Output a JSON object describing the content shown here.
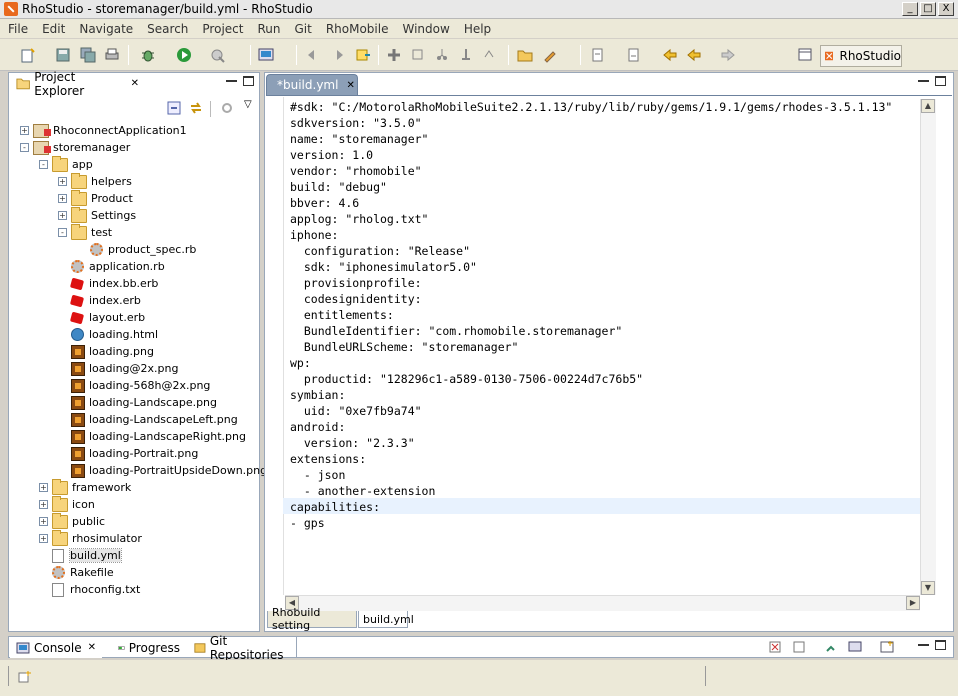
{
  "window": {
    "title": "RhoStudio - storemanager/build.yml - RhoStudio",
    "min": "_",
    "max": "□",
    "close": "X"
  },
  "menu": [
    "File",
    "Edit",
    "Navigate",
    "Search",
    "Project",
    "Run",
    "Git",
    "RhoMobile",
    "Window",
    "Help"
  ],
  "toolbar": {
    "perspective_label": "RhoStudio"
  },
  "project_explorer": {
    "tab_label": "Project Explorer",
    "tree": [
      {
        "label": "RhoconnectApplication1",
        "icon": "project-icon",
        "depth": 0,
        "toggle": "+"
      },
      {
        "label": "storemanager",
        "icon": "project-icon",
        "depth": 0,
        "toggle": "-"
      },
      {
        "label": "app",
        "icon": "folder-icon",
        "depth": 1,
        "toggle": "-"
      },
      {
        "label": "helpers",
        "icon": "folder-icon",
        "depth": 2,
        "toggle": "+"
      },
      {
        "label": "Product",
        "icon": "folder-icon",
        "depth": 2,
        "toggle": "+"
      },
      {
        "label": "Settings",
        "icon": "folder-icon",
        "depth": 2,
        "toggle": "+"
      },
      {
        "label": "test",
        "icon": "folder-icon",
        "depth": 2,
        "toggle": "-"
      },
      {
        "label": "product_spec.rb",
        "icon": "ruby-script-icon",
        "depth": 3
      },
      {
        "label": "application.rb",
        "icon": "ruby-script-icon",
        "depth": 2
      },
      {
        "label": "index.bb.erb",
        "icon": "ruby-icon",
        "depth": 2
      },
      {
        "label": "index.erb",
        "icon": "ruby-icon",
        "depth": 2
      },
      {
        "label": "layout.erb",
        "icon": "ruby-icon",
        "depth": 2
      },
      {
        "label": "loading.html",
        "icon": "globe-icon",
        "depth": 2
      },
      {
        "label": "loading.png",
        "icon": "image-icon",
        "depth": 2
      },
      {
        "label": "loading@2x.png",
        "icon": "image-icon",
        "depth": 2
      },
      {
        "label": "loading-568h@2x.png",
        "icon": "image-icon",
        "depth": 2
      },
      {
        "label": "loading-Landscape.png",
        "icon": "image-icon",
        "depth": 2
      },
      {
        "label": "loading-LandscapeLeft.png",
        "icon": "image-icon",
        "depth": 2
      },
      {
        "label": "loading-LandscapeRight.png",
        "icon": "image-icon",
        "depth": 2
      },
      {
        "label": "loading-Portrait.png",
        "icon": "image-icon",
        "depth": 2
      },
      {
        "label": "loading-PortraitUpsideDown.png",
        "icon": "image-icon",
        "depth": 2
      },
      {
        "label": "framework",
        "icon": "folder-icon",
        "depth": 1,
        "toggle": "+"
      },
      {
        "label": "icon",
        "icon": "folder-icon",
        "depth": 1,
        "toggle": "+"
      },
      {
        "label": "public",
        "icon": "folder-icon",
        "depth": 1,
        "toggle": "+"
      },
      {
        "label": "rhosimulator",
        "icon": "folder-icon",
        "depth": 1,
        "toggle": "+"
      },
      {
        "label": "build.yml",
        "icon": "file-icon",
        "depth": 1,
        "selected": true
      },
      {
        "label": "Rakefile",
        "icon": "ruby-script-icon",
        "depth": 1
      },
      {
        "label": "rhoconfig.txt",
        "icon": "file-icon",
        "depth": 1
      }
    ]
  },
  "editor": {
    "tab_label": "*build.yml",
    "lines": [
      "#sdk: \"C:/MotorolaRhoMobileSuite2.2.1.13/ruby/lib/ruby/gems/1.9.1/gems/rhodes-3.5.1.13\"",
      "sdkversion: \"3.5.0\"",
      "name: \"storemanager\"",
      "version: 1.0",
      "vendor: \"rhomobile\"",
      "build: \"debug\"",
      "bbver: 4.6",
      "applog: \"rholog.txt\"",
      "iphone:",
      "  configuration: \"Release\"",
      "  sdk: \"iphonesimulator5.0\"",
      "  provisionprofile:",
      "  codesignidentity:",
      "  entitlements:",
      "  BundleIdentifier: \"com.rhomobile.storemanager\"",
      "  BundleURLScheme: \"storemanager\"",
      "wp:",
      "  productid: \"128296c1-a589-0130-7506-00224d7c76b5\"",
      "symbian:",
      "  uid: \"0xe7fb9a74\"",
      "android:",
      "  version: \"2.3.3\"",
      "extensions:",
      "  - json",
      "  - another-extension",
      "capabilities:",
      "- gps"
    ],
    "bottom_tabs": [
      "Rhobuild setting",
      "build.yml"
    ]
  },
  "bottom_views": {
    "tabs": [
      "Console",
      "Progress",
      "Git Repositories"
    ]
  }
}
